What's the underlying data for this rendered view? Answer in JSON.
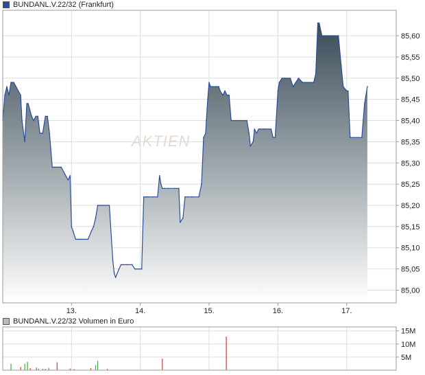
{
  "watermark": "AKTIEN",
  "colors": {
    "line": "#2a4d9a",
    "fill_top": "#3a4c57",
    "fill_bottom": "#ffffff",
    "grid": "#dddddd",
    "frame": "#9a9a9a",
    "price_swatch": "#2a4d9a",
    "volume_swatch": "#bbbbbb",
    "volume_up": "#3fae3f",
    "volume_down": "#d23a3a"
  },
  "chart_data": [
    {
      "type": "area",
      "legend": "BUNDANL.V.22/32 (Frankfurt)",
      "title": "",
      "xlabel": "",
      "ylabel": "",
      "x_range": [
        12.0,
        17.72
      ],
      "ylim": [
        84.97,
        85.66
      ],
      "x_ticks": [
        {
          "x": 13,
          "label": "13."
        },
        {
          "x": 14,
          "label": "14."
        },
        {
          "x": 15,
          "label": "15."
        },
        {
          "x": 16,
          "label": "16."
        },
        {
          "x": 17,
          "label": "17."
        }
      ],
      "y_ticks": [
        {
          "y": 85.0,
          "label": "85,00"
        },
        {
          "y": 85.05,
          "label": "85,05"
        },
        {
          "y": 85.1,
          "label": "85,10"
        },
        {
          "y": 85.15,
          "label": "85,15"
        },
        {
          "y": 85.2,
          "label": "85,20"
        },
        {
          "y": 85.25,
          "label": "85,25"
        },
        {
          "y": 85.3,
          "label": "85,30"
        },
        {
          "y": 85.35,
          "label": "85,35"
        },
        {
          "y": 85.4,
          "label": "85,40"
        },
        {
          "y": 85.45,
          "label": "85,45"
        },
        {
          "y": 85.5,
          "label": "85,50"
        },
        {
          "y": 85.55,
          "label": "85,55"
        },
        {
          "y": 85.6,
          "label": "85,60"
        }
      ],
      "grid": true,
      "series": [
        {
          "x": [
            12.0,
            12.03,
            12.06,
            12.09,
            12.12,
            12.16,
            12.26,
            12.28,
            12.32,
            12.35,
            12.37,
            12.42,
            12.45,
            12.48,
            12.51,
            12.54,
            12.58,
            12.62,
            12.65,
            12.68,
            12.72,
            12.75,
            12.78,
            12.81,
            12.85,
            12.95,
            12.98,
            13.0,
            13.02,
            13.06,
            13.1,
            13.14,
            13.24,
            13.29,
            13.32,
            13.35,
            13.38,
            13.41,
            13.45,
            13.55,
            13.6,
            13.62,
            13.64,
            13.69,
            13.72,
            13.75,
            13.8,
            13.88,
            13.92,
            13.98,
            14.02,
            14.05,
            14.08,
            14.1,
            14.12,
            14.18,
            14.25,
            14.28,
            14.3,
            14.32,
            14.35,
            14.4,
            14.5,
            14.56,
            14.58,
            14.62,
            14.65,
            14.69,
            14.75,
            14.85,
            14.89,
            14.92,
            14.95,
            14.96,
            14.98,
            15.0,
            15.02,
            15.04,
            15.06,
            15.1,
            15.14,
            15.16,
            15.2,
            15.23,
            15.26,
            15.29,
            15.32,
            15.4,
            15.55,
            15.58,
            15.6,
            15.64,
            15.66,
            15.69,
            15.72,
            15.8,
            15.9,
            15.93,
            15.96,
            16.0,
            16.02,
            16.06,
            16.1,
            16.18,
            16.22,
            16.26,
            16.3,
            16.36,
            16.47,
            16.52,
            16.55,
            16.58,
            16.6,
            16.64,
            16.69,
            16.82,
            16.88,
            16.92,
            16.95,
            17.0,
            17.02,
            17.05,
            17.1,
            17.16,
            17.22,
            17.26,
            17.3
          ],
          "y": [
            85.4,
            85.46,
            85.48,
            85.46,
            85.49,
            85.49,
            85.46,
            85.4,
            85.35,
            85.44,
            85.44,
            85.41,
            85.4,
            85.41,
            85.41,
            85.37,
            85.37,
            85.41,
            85.41,
            85.37,
            85.29,
            85.29,
            85.29,
            85.29,
            85.29,
            85.26,
            85.27,
            85.15,
            85.14,
            85.12,
            85.12,
            85.12,
            85.12,
            85.14,
            85.15,
            85.17,
            85.2,
            85.2,
            85.2,
            85.2,
            85.07,
            85.04,
            85.03,
            85.05,
            85.06,
            85.06,
            85.06,
            85.06,
            85.05,
            85.05,
            85.05,
            85.22,
            85.22,
            85.22,
            85.22,
            85.22,
            85.22,
            85.27,
            85.25,
            85.24,
            85.24,
            85.24,
            85.24,
            85.24,
            85.16,
            85.17,
            85.22,
            85.22,
            85.22,
            85.22,
            85.25,
            85.36,
            85.37,
            85.4,
            85.45,
            85.49,
            85.48,
            85.48,
            85.48,
            85.48,
            85.48,
            85.47,
            85.46,
            85.47,
            85.46,
            85.46,
            85.4,
            85.4,
            85.4,
            85.37,
            85.34,
            85.35,
            85.38,
            85.37,
            85.38,
            85.38,
            85.38,
            85.36,
            85.36,
            85.47,
            85.49,
            85.5,
            85.5,
            85.5,
            85.48,
            85.49,
            85.5,
            85.49,
            85.49,
            85.49,
            85.51,
            85.63,
            85.63,
            85.6,
            85.6,
            85.6,
            85.6,
            85.53,
            85.48,
            85.47,
            85.47,
            85.36,
            85.36,
            85.36,
            85.36,
            85.44,
            85.48
          ]
        }
      ]
    },
    {
      "type": "bar",
      "legend": "BUNDANL.V.22/32 Volumen in Euro",
      "title": "",
      "xlabel": "",
      "ylabel": "",
      "x_range": [
        12.0,
        17.72
      ],
      "ylim": [
        0,
        16.5
      ],
      "y_ticks": [
        {
          "y": 5,
          "label": "5M"
        },
        {
          "y": 10,
          "label": "10M"
        },
        {
          "y": 15,
          "label": "15M"
        }
      ],
      "series": [
        {
          "x": [
            12.12,
            12.26,
            12.32,
            12.36,
            12.4,
            12.49,
            12.52,
            12.58,
            12.62,
            12.67,
            12.79,
            12.98,
            13.04,
            13.28,
            13.35,
            13.38,
            13.52,
            14.32,
            15.25
          ],
          "y": [
            2.5,
            1.2,
            2.5,
            3.2,
            0.8,
            1.0,
            0.6,
            0.5,
            0.5,
            0.9,
            3.0,
            0.6,
            0.4,
            0.8,
            2.0,
            3.6,
            0.5,
            4.4,
            12.8
          ],
          "direction": [
            "up",
            "down",
            "up",
            "up",
            "down",
            "down",
            "up",
            "down",
            "down",
            "up",
            "down",
            "down",
            "down",
            "down",
            "up",
            "up",
            "down",
            "down",
            "down"
          ]
        }
      ]
    }
  ]
}
